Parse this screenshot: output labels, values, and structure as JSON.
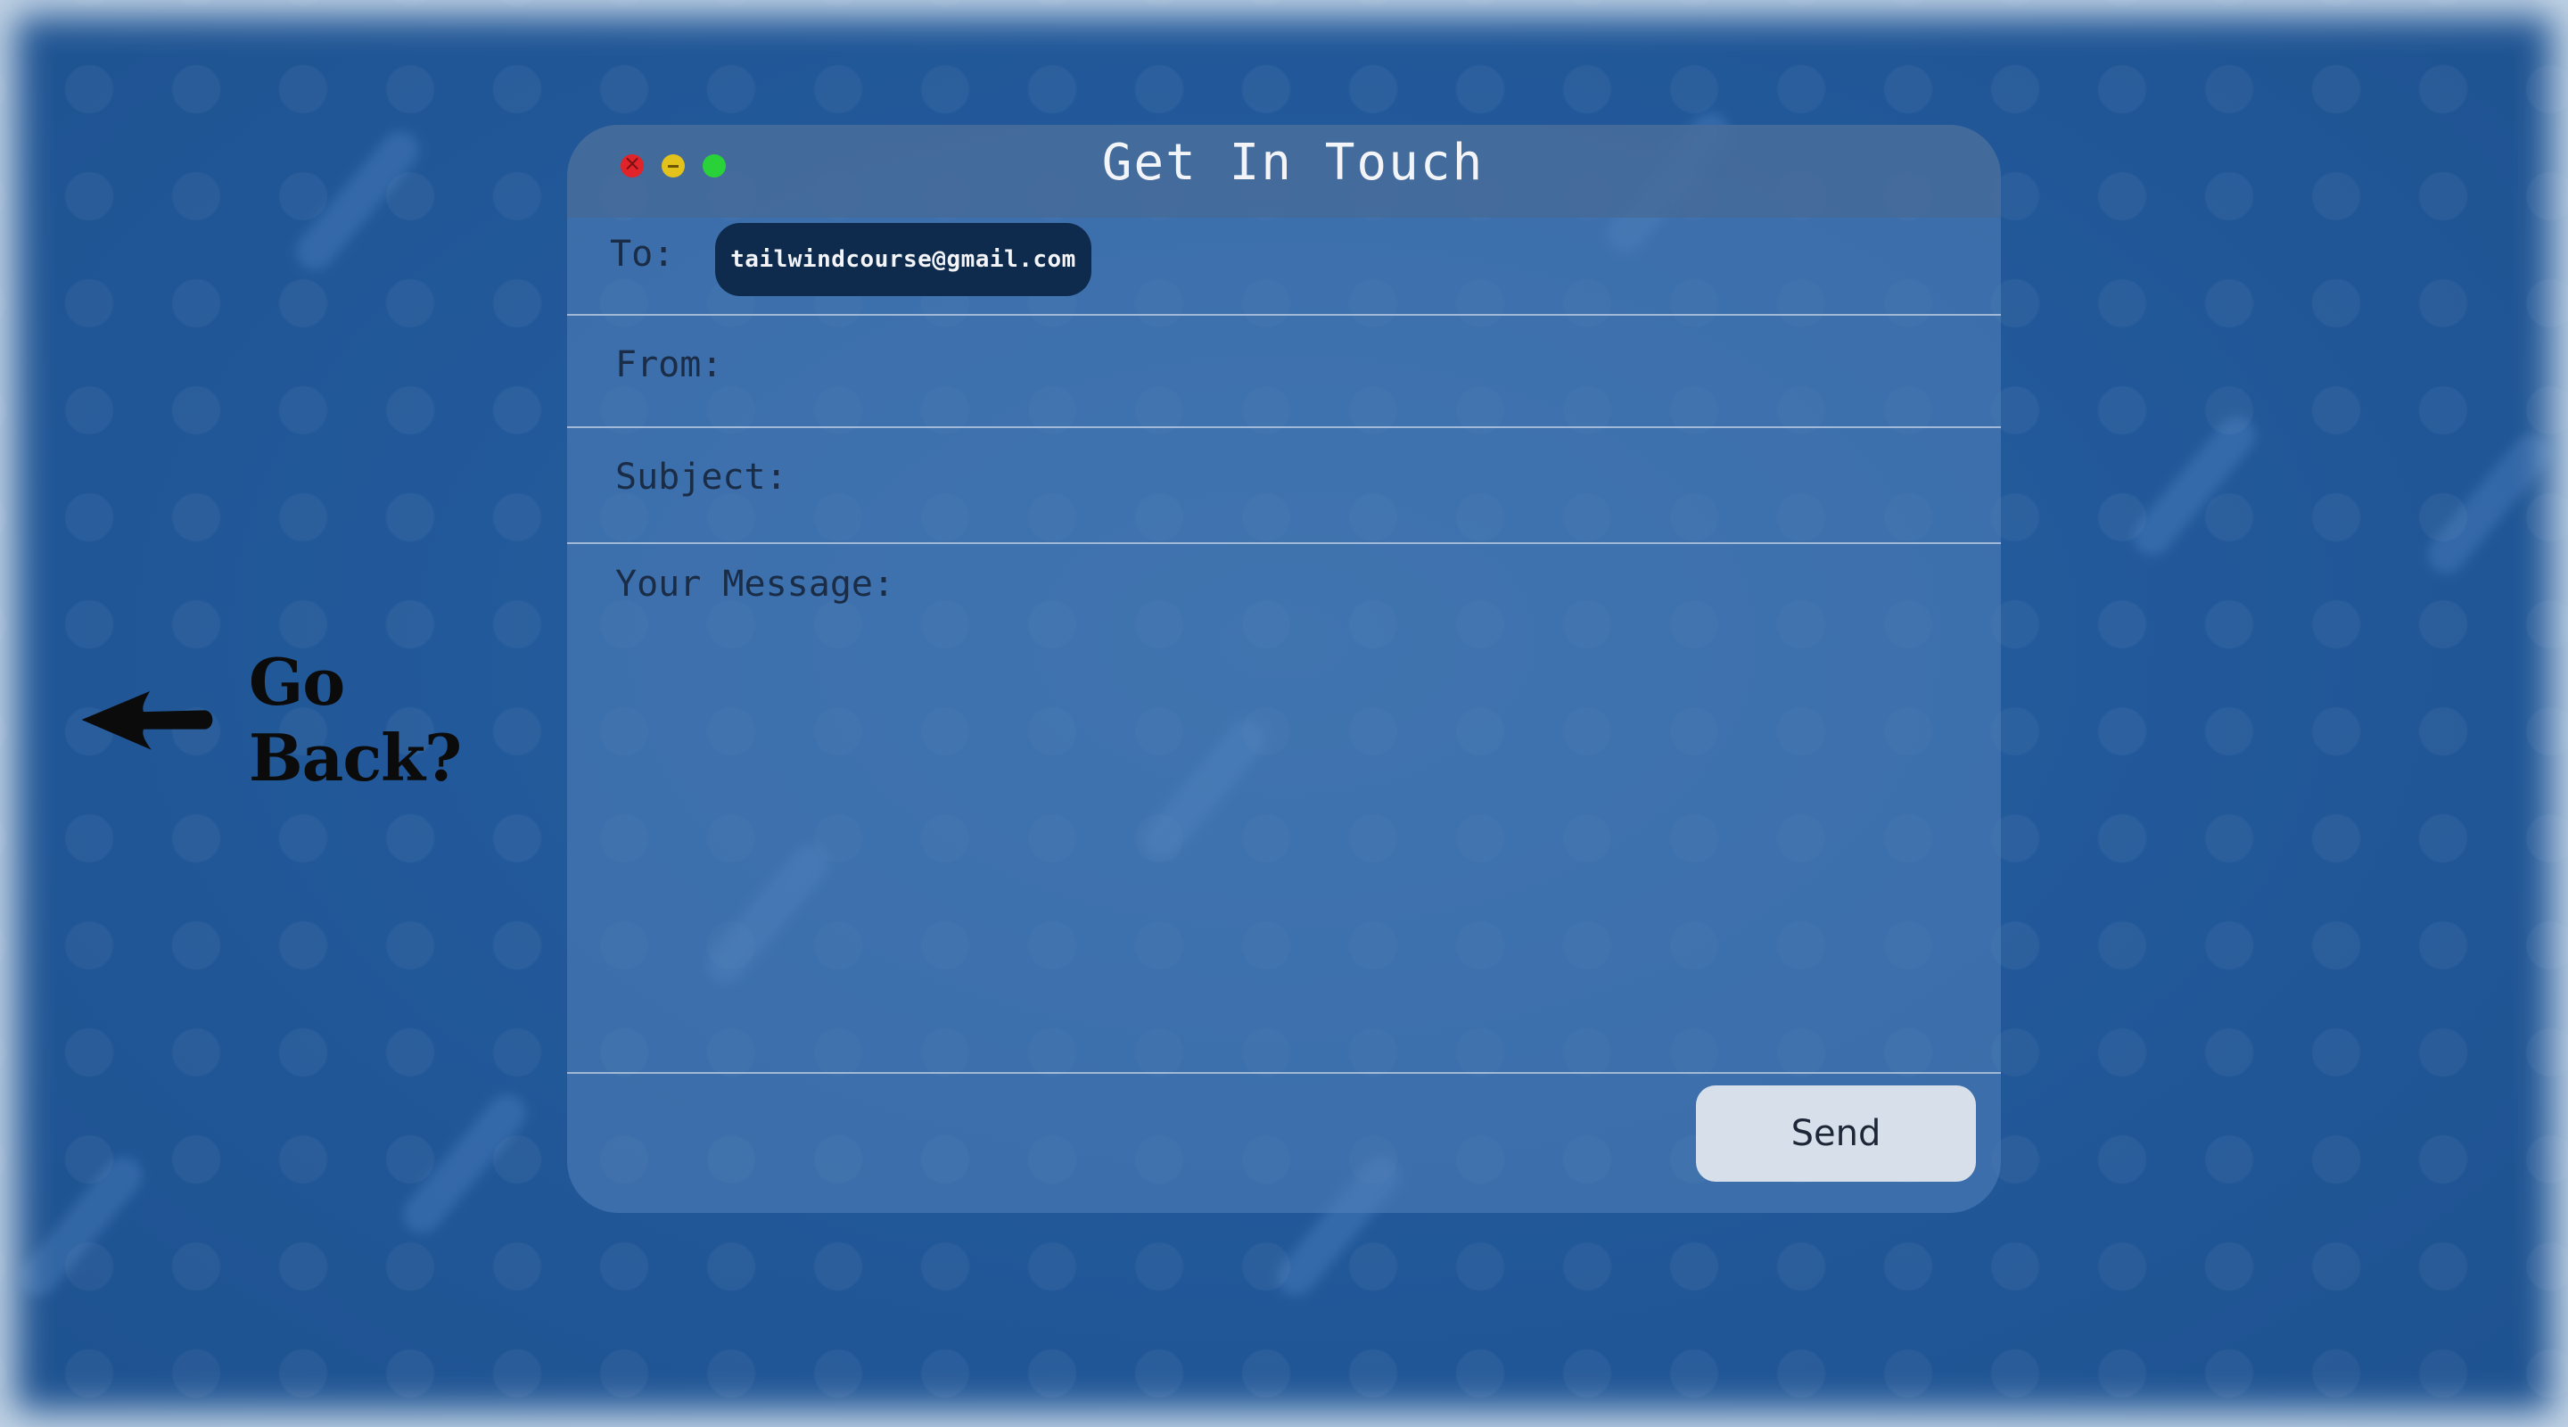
{
  "window": {
    "title": "Get In Touch"
  },
  "form": {
    "to_label": "To:",
    "to_value": "tailwindcourse@gmail.com",
    "from_label": "From:",
    "from_value": "",
    "subject_label": "Subject:",
    "subject_value": "",
    "message_label": "Your Message:",
    "message_value": "",
    "send_label": "Send"
  },
  "nav": {
    "go_back_label": "Go Back?",
    "arrow_icon": "arrow-left-icon"
  },
  "colors": {
    "background": "#1f5490",
    "window": "#5282b9",
    "titlebar": "#46699a",
    "chip": "#0e2a4c",
    "send_button": "#d7e0ea",
    "close": "#e0242a",
    "minimize": "#e2c21b",
    "maximize": "#2ad23a"
  }
}
